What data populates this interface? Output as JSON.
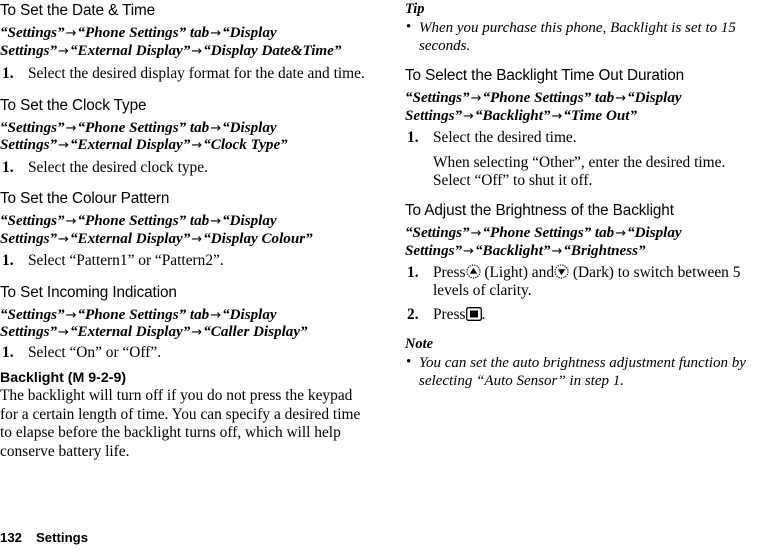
{
  "document": {
    "footer": {
      "page_number": "132",
      "section": "Settings"
    }
  },
  "left_column": {
    "s1": {
      "heading": "To Set the Date & Time",
      "path": [
        "“Settings”",
        "“Phone Settings” tab",
        "“Display Settings”",
        "“External Display”",
        "“Display Date&Time”"
      ],
      "step1_num": "1.",
      "step1_text": "Select the desired display format for the date and time."
    },
    "s2": {
      "heading": "To Set the Clock Type",
      "path": [
        "“Settings”",
        "“Phone Settings” tab",
        "“Display Settings”",
        "“External Display”",
        "“Clock Type”"
      ],
      "step1_num": "1.",
      "step1_text": "Select the desired clock type."
    },
    "s3": {
      "heading": "To Set the Colour Pattern",
      "path": [
        "“Settings”",
        "“Phone Settings” tab",
        "“Display Settings”",
        "“External Display”",
        "“Display Colour”"
      ],
      "step1_num": "1.",
      "step1_text": "Select “Pattern1” or “Pattern2”."
    },
    "s4": {
      "heading": "To Set Incoming Indication",
      "path": [
        "“Settings”",
        "“Phone Settings” tab",
        "“Display Settings”",
        "“External Display”",
        "“Caller Display”"
      ],
      "step1_num": "1.",
      "step1_text": "Select “On” or “Off”."
    },
    "s5": {
      "heading": "Backlight (M 9-2-9)",
      "body": "The backlight will turn off if you do not press the keypad for a certain length of time. You can specify a desired time to elapse before the backlight turns off, which will help conserve battery life."
    }
  },
  "right_column": {
    "tip": {
      "label": "Tip",
      "bullet": "•",
      "text": "When you purchase this phone, Backlight is set to 15 seconds."
    },
    "s6": {
      "heading": "To Select the Backlight Time Out Duration",
      "path": [
        "“Settings”",
        "“Phone Settings” tab",
        "“Display Settings”",
        "“Backlight”",
        "“Time Out”"
      ],
      "step1_num": "1.",
      "step1_text": "Select the desired time.",
      "step1_note": "When selecting “Other”, enter the desired time. Select “Off” to shut it off."
    },
    "s7": {
      "heading": "To Adjust the Brightness of the Backlight",
      "path": [
        "“Settings”",
        "“Phone Settings” tab",
        "“Display Settings”",
        "“Backlight”",
        "“Brightness”"
      ],
      "step1_num": "1.",
      "step1_prefix": "Press",
      "step1_light_label": "(Light) and",
      "step1_dark_label": "(Dark) to switch between 5 levels of clarity.",
      "step2_num": "2.",
      "step2_prefix": "Press",
      "step2_suffix": "."
    },
    "note": {
      "label": "Note",
      "bullet": "•",
      "text": "You can set the auto brightness adjustment function by selecting “Auto Sensor” in step 1."
    }
  },
  "icons": {
    "up_key": "navigation-up-key-icon",
    "down_key": "navigation-down-key-icon",
    "center_key": "center-select-key-icon"
  },
  "arrow_glyph": "→"
}
